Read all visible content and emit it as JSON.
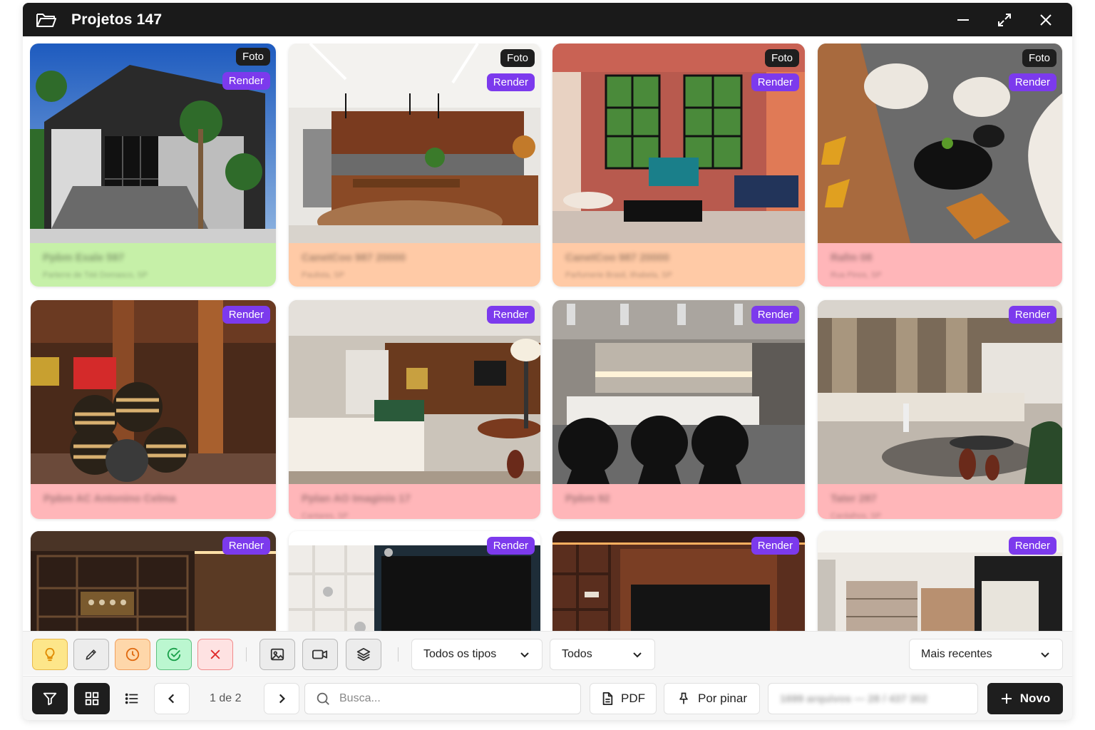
{
  "window": {
    "title": "Projetos 147"
  },
  "badges": {
    "foto": "Foto",
    "render": "Render"
  },
  "cards": [
    {
      "name": "Ppbm Exale 597",
      "location": "Parterre de Téé Domasco, SP",
      "foto": true,
      "render": true,
      "info_color": "#c6f0a8"
    },
    {
      "name": "CanetCoo 987 20000",
      "location": "Paulista, SP",
      "foto": true,
      "render": true,
      "info_color": "#ffcaa6"
    },
    {
      "name": "CanetCoo 987 20000",
      "location": "Parfumerie Brasil, Ilhabela, SP",
      "foto": true,
      "render": true,
      "info_color": "#ffcaa6"
    },
    {
      "name": "Rafm 08",
      "location": "Rua Pinos, SP",
      "foto": true,
      "render": true,
      "info_color": "#ffb6b9"
    },
    {
      "name": "Ppbm AC Antonino Celma",
      "location": "",
      "foto": false,
      "render": true,
      "info_color": "#ffb6b9"
    },
    {
      "name": "Pplan AO Imaginis 17",
      "location": "Cantares, SP",
      "foto": false,
      "render": true,
      "info_color": "#ffb6b9"
    },
    {
      "name": "Ppbm 92",
      "location": "",
      "foto": false,
      "render": true,
      "info_color": "#ffb6b9"
    },
    {
      "name": "Tater 287",
      "location": "Cardalhos, SP",
      "foto": false,
      "render": true,
      "info_color": "#ffb6b9"
    },
    {
      "name": "",
      "location": "",
      "foto": false,
      "render": true,
      "info_color": "#ffb6b9"
    },
    {
      "name": "",
      "location": "",
      "foto": false,
      "render": true,
      "info_color": "#ffb6b9"
    },
    {
      "name": "",
      "location": "",
      "foto": false,
      "render": true,
      "info_color": "#ffb6b9"
    },
    {
      "name": "",
      "location": "",
      "foto": false,
      "render": true,
      "info_color": "#ffb6b9"
    }
  ],
  "filters": {
    "type_selected": "Todos os tipos",
    "scope_selected": "Todos",
    "sort_selected": "Mais recentes"
  },
  "pagination": {
    "label": "1 de 2"
  },
  "search": {
    "placeholder": "Busca..."
  },
  "actions": {
    "pdf_label": "PDF",
    "pin_label": "Por pinar",
    "status_text": "1699 arquivos — 28 / 437 302",
    "new_label": "Novo"
  },
  "colors": {
    "render_badge": "#7c3aed",
    "foto_badge": "#1e1e1e",
    "titlebar": "#1a1a1a",
    "idea_status": "#fde68a",
    "pending_status": "#fed7aa",
    "approved_status": "#bbf7d0",
    "rejected_status": "#fecaca"
  }
}
